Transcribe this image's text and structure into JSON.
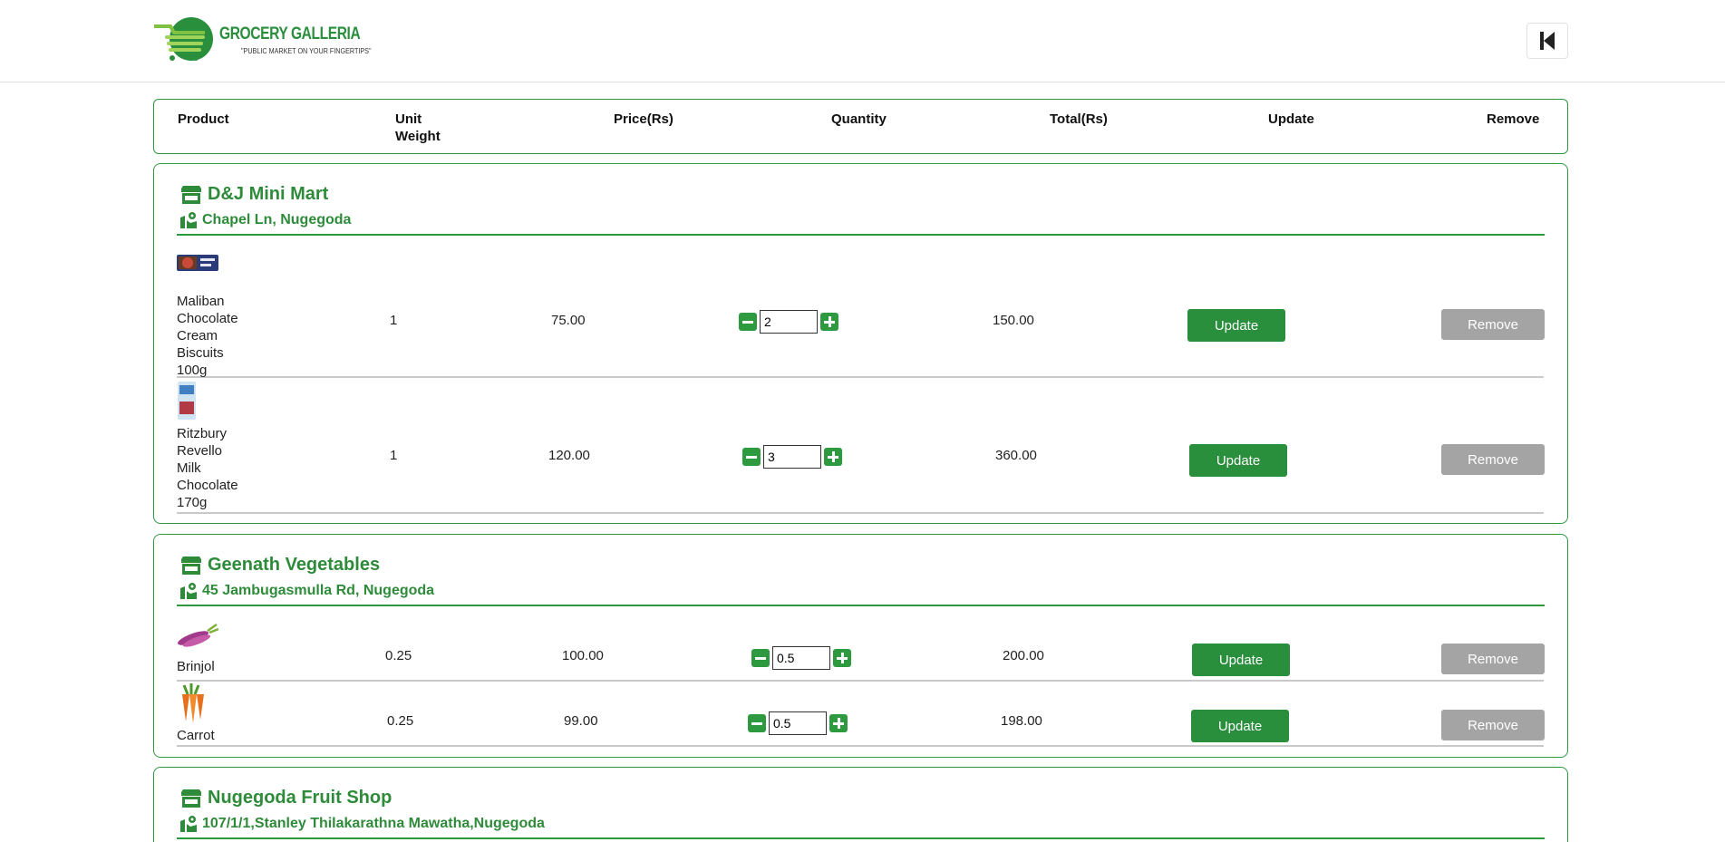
{
  "logo": {
    "brand": "GROCERY GALLERIA",
    "tagline": "\"PUBLIC MARKET ON YOUR FINGERTIPS\""
  },
  "header": {
    "columns": {
      "product": "Product",
      "unit_weight": "Unit Weight",
      "price": "Price(Rs)",
      "quantity": "Quantity",
      "total": "Total(Rs)",
      "update": "Update",
      "remove": "Remove"
    }
  },
  "buttons": {
    "update": "Update",
    "remove": "Remove"
  },
  "shops": [
    {
      "name": "D&J Mini Mart",
      "address": "Chapel Ln, Nugegoda",
      "items": [
        {
          "name": "Maliban Chocolate Cream Biscuits 100g",
          "unit": "1",
          "price": "75.00",
          "qty": "2",
          "total": "150.00"
        },
        {
          "name": "Ritzbury Revello Milk Chocolate 170g",
          "unit": "1",
          "price": "120.00",
          "qty": "3",
          "total": "360.00"
        }
      ]
    },
    {
      "name": "Geenath Vegetables",
      "address": "45 Jambugasmulla Rd, Nugegoda",
      "items": [
        {
          "name": "Brinjol",
          "unit": "0.25",
          "price": "100.00",
          "qty": "0.5",
          "total": "200.00"
        },
        {
          "name": "Carrot",
          "unit": "0.25",
          "price": "99.00",
          "qty": "0.5",
          "total": "198.00"
        }
      ]
    },
    {
      "name": "Nugegoda Fruit Shop",
      "address": "107/1/1,Stanley Thilakarathna Mawatha,Nugegoda",
      "items": []
    }
  ]
}
